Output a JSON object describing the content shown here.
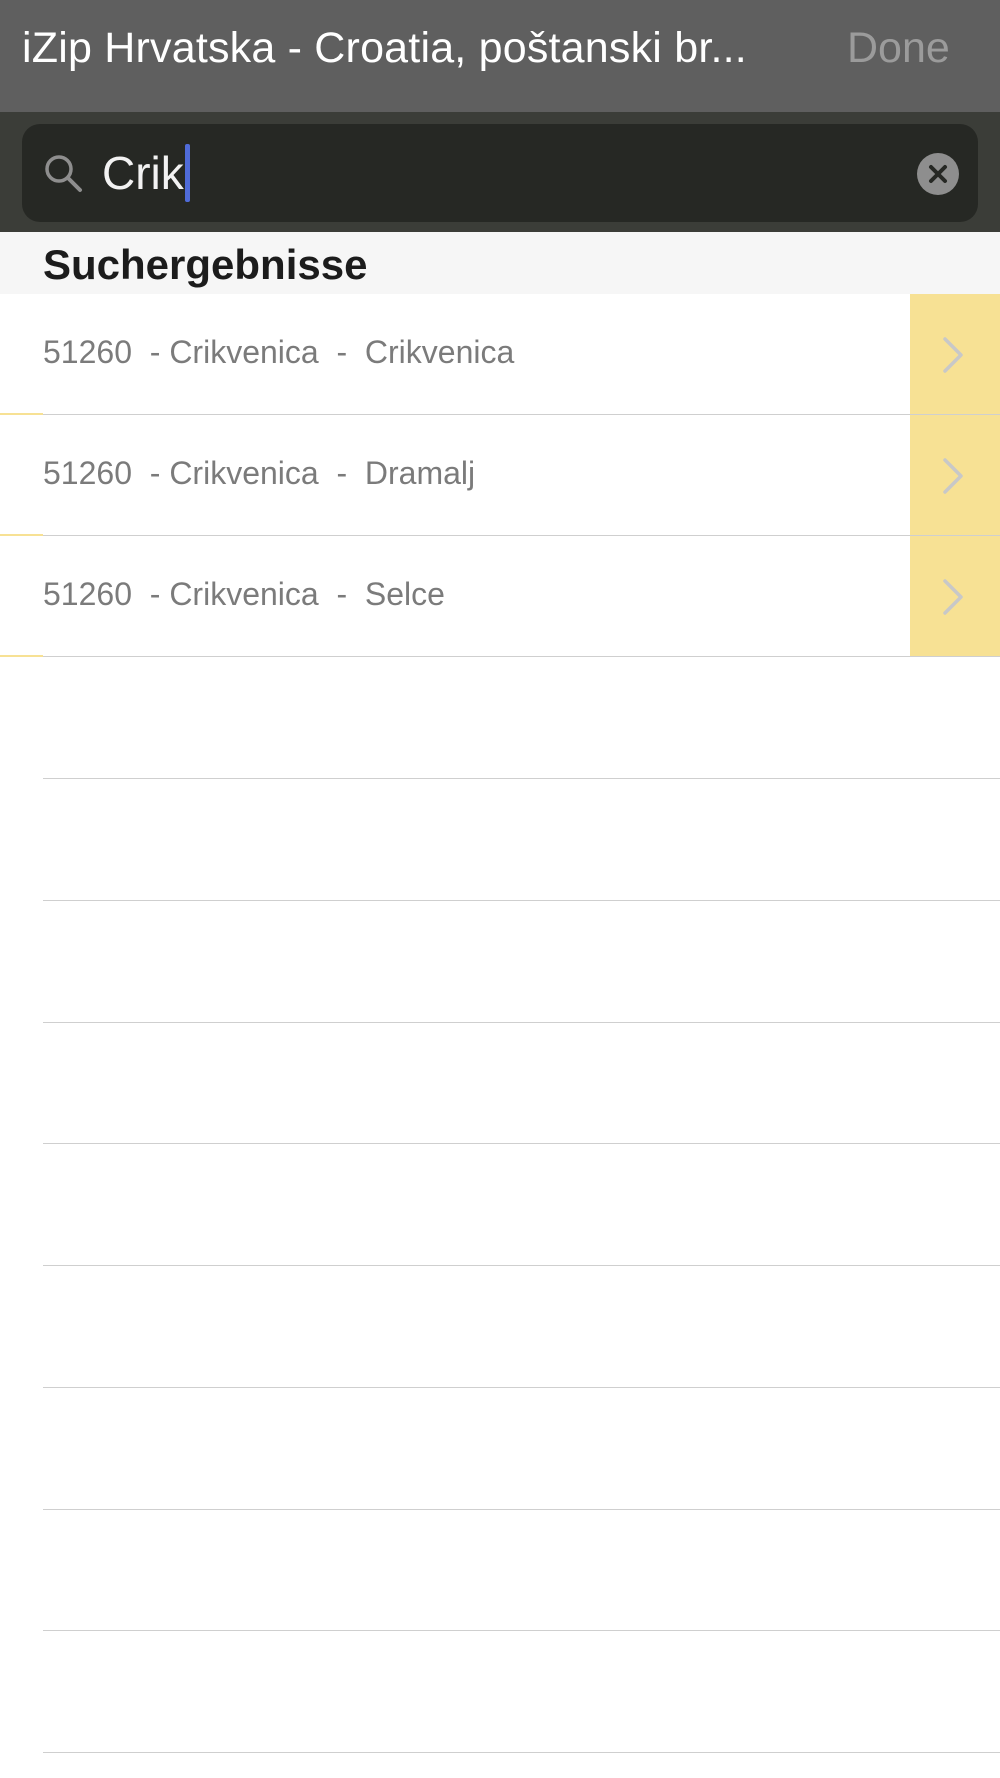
{
  "navbar": {
    "title": "iZip Hrvatska - Croatia, poštanski br...",
    "done_label": "Done"
  },
  "search": {
    "value": "Crik"
  },
  "section": {
    "title": "Suchergebnisse"
  },
  "results": [
    {
      "label": "51260  - Crikvenica  -  Crikvenica"
    },
    {
      "label": "51260  - Crikvenica  -  Dramalj"
    },
    {
      "label": "51260  - Crikvenica  -  Selce"
    }
  ],
  "colors": {
    "navbar_bg": "#5f5f5f",
    "search_bg": "#3b3d38",
    "accessory_yellow": "#f7e194",
    "caret_blue": "#4f6bd8"
  }
}
